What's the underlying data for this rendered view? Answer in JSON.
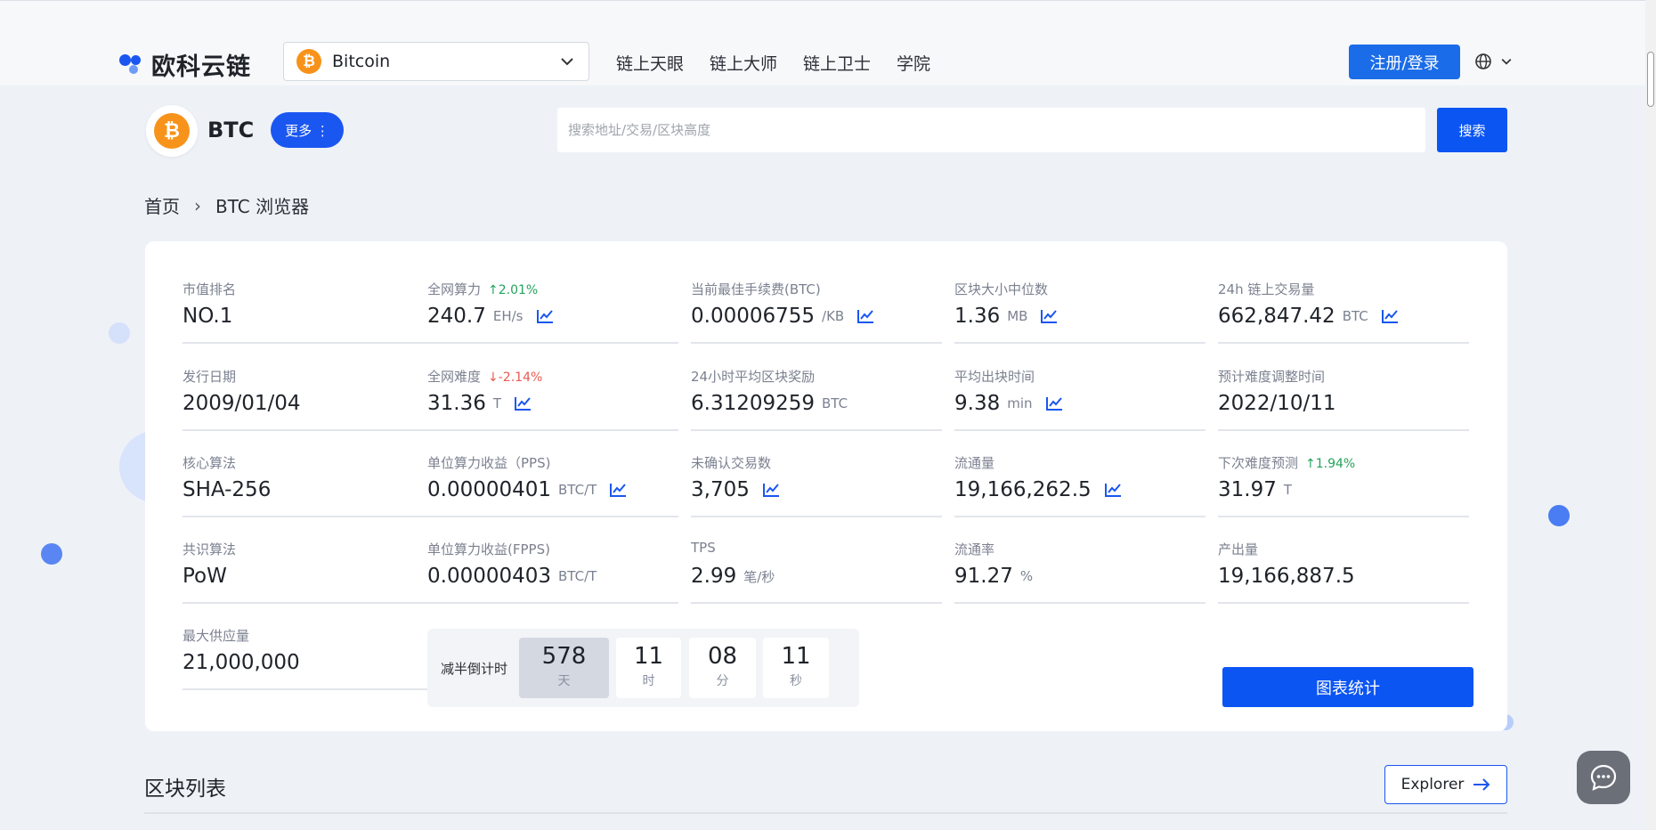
{
  "header": {
    "logo_text": "欧科云链",
    "chain_selector": "Bitcoin",
    "nav": [
      "链上天眼",
      "链上大师",
      "链上卫士",
      "学院"
    ],
    "login": "注册/登录",
    "icons": {
      "language": "globe-icon",
      "chevron": "chevron-down-icon"
    }
  },
  "coin": {
    "symbol": "BTC",
    "more": "更多 ⋮",
    "glyph": "₿"
  },
  "search": {
    "placeholder": "搜索地址/交易/区块高度",
    "button": "搜索"
  },
  "breadcrumb": {
    "home": "首页",
    "current": "BTC 浏览器"
  },
  "stats": [
    {
      "label": "市值排名",
      "value": "NO.1"
    },
    {
      "label": "全网算力",
      "change": "2.01%",
      "change_dir": "up",
      "value": "240.7",
      "unit": "EH/s",
      "chart": true
    },
    {
      "label": "当前最佳手续费(BTC)",
      "value": "0.00006755",
      "unit": "/KB",
      "chart": true
    },
    {
      "label": "区块大小中位数",
      "value": "1.36",
      "unit": "MB",
      "chart": true
    },
    {
      "label": "24h 链上交易量",
      "value": "662,847.42",
      "unit": "BTC",
      "chart": true
    },
    {
      "label": "发行日期",
      "value": "2009/01/04"
    },
    {
      "label": "全网难度",
      "change": "-2.14%",
      "change_dir": "down",
      "value": "31.36",
      "unit": "T",
      "chart": true
    },
    {
      "label": "24小时平均区块奖励",
      "value": "6.31209259",
      "unit": "BTC"
    },
    {
      "label": "平均出块时间",
      "value": "9.38",
      "unit": "min",
      "chart": true
    },
    {
      "label": "预计难度调整时间",
      "value": "2022/10/11"
    },
    {
      "label": "核心算法",
      "value": "SHA-256"
    },
    {
      "label": "单位算力收益（PPS)",
      "value": "0.00000401",
      "unit": "BTC/T",
      "chart": true
    },
    {
      "label": "未确认交易数",
      "value": "3,705",
      "chart": true
    },
    {
      "label": "流通量",
      "value": "19,166,262.5",
      "chart": true
    },
    {
      "label": "下次难度预测",
      "change": "1.94%",
      "change_dir": "up",
      "value": "31.97",
      "unit": "T"
    },
    {
      "label": "共识算法",
      "value": "PoW"
    },
    {
      "label": "单位算力收益(FPPS)",
      "value": "0.00000403",
      "unit": "BTC/T"
    },
    {
      "label": "TPS",
      "value": "2.99",
      "unit": "笔/秒"
    },
    {
      "label": "流通率",
      "value": "91.27",
      "unit": "%"
    },
    {
      "label": "产出量",
      "value": "19,166,887.5"
    },
    {
      "label": "最大供应量",
      "value": "21,000,000"
    }
  ],
  "halving": {
    "label": "减半倒计时",
    "boxes": [
      {
        "num": "578",
        "unit": "天"
      },
      {
        "num": "11",
        "unit": "时"
      },
      {
        "num": "08",
        "unit": "分"
      },
      {
        "num": "11",
        "unit": "秒"
      }
    ]
  },
  "chart_button": "图表统计",
  "block_list": {
    "title": "区块列表",
    "explorer": "Explorer"
  },
  "colors": {
    "primary": "#0b55f3",
    "up": "#24a35c",
    "down": "#e85a50",
    "bitcoin": "#f7931a"
  }
}
